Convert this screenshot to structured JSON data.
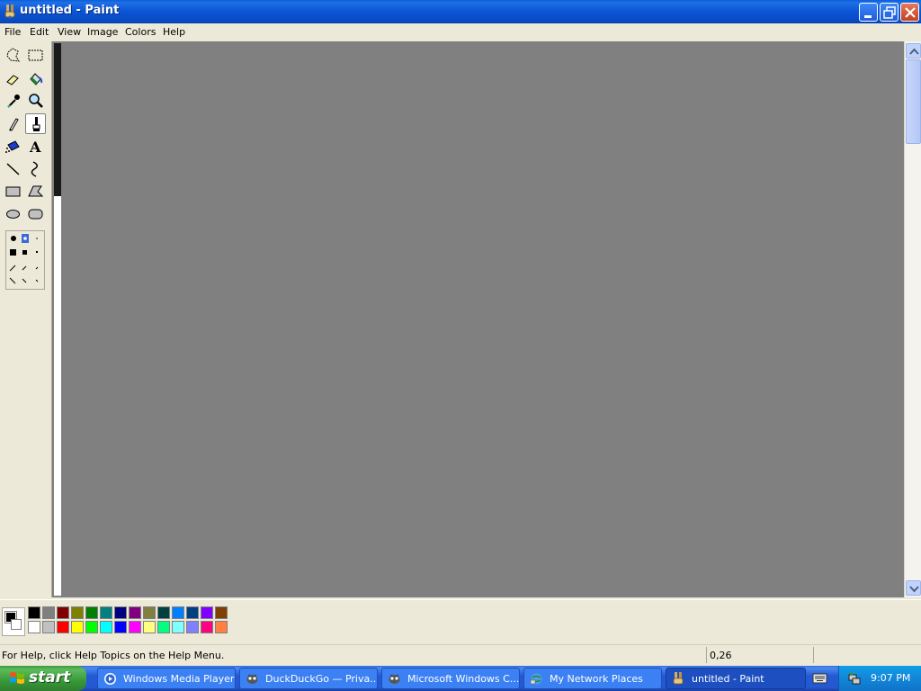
{
  "window": {
    "title": "untitled - Paint",
    "controls": {
      "minimize": "minimize",
      "maximize": "restore",
      "close": "close"
    }
  },
  "menubar": {
    "items": [
      {
        "label": "File"
      },
      {
        "label": "Edit"
      },
      {
        "label": "View"
      },
      {
        "label": "Image"
      },
      {
        "label": "Colors"
      },
      {
        "label": "Help"
      }
    ]
  },
  "toolbox": {
    "tools": [
      {
        "name": "free-form-select",
        "icon": "free-form-select-icon"
      },
      {
        "name": "select",
        "icon": "rectangle-select-icon"
      },
      {
        "name": "eraser",
        "icon": "eraser-icon"
      },
      {
        "name": "fill-with-color",
        "icon": "paint-bucket-icon"
      },
      {
        "name": "pick-color",
        "icon": "eyedropper-icon"
      },
      {
        "name": "magnifier",
        "icon": "magnifier-icon"
      },
      {
        "name": "pencil",
        "icon": "pencil-icon"
      },
      {
        "name": "brush",
        "icon": "brush-icon",
        "selected": true
      },
      {
        "name": "airbrush",
        "icon": "airbrush-icon"
      },
      {
        "name": "text",
        "icon": "text-icon"
      },
      {
        "name": "line",
        "icon": "line-icon"
      },
      {
        "name": "curve",
        "icon": "curve-icon"
      },
      {
        "name": "rectangle",
        "icon": "rectangle-icon"
      },
      {
        "name": "polygon",
        "icon": "polygon-icon"
      },
      {
        "name": "ellipse",
        "icon": "ellipse-icon"
      },
      {
        "name": "rounded-rectangle",
        "icon": "rounded-rectangle-icon"
      }
    ],
    "text_tool_glyph": "A"
  },
  "palette": {
    "foreground": "#000000",
    "background": "#ffffff",
    "colors_row1": [
      "#000000",
      "#808080",
      "#800000",
      "#808000",
      "#008000",
      "#008080",
      "#000080",
      "#800080",
      "#808040",
      "#004040",
      "#0080ff",
      "#004080",
      "#8000ff",
      "#804000"
    ],
    "colors_row2": [
      "#ffffff",
      "#c0c0c0",
      "#ff0000",
      "#ffff00",
      "#00ff00",
      "#00ffff",
      "#0000ff",
      "#ff00ff",
      "#ffff80",
      "#00ff80",
      "#80ffff",
      "#8080ff",
      "#ff0080",
      "#ff8040"
    ]
  },
  "statusbar": {
    "help_text": "For Help, click Help Topics on the Help Menu.",
    "coordinates": "0,26"
  },
  "taskbar": {
    "start_label": "start",
    "tasks": [
      {
        "label": "Windows Media Player",
        "icon": "media-player-icon",
        "active": false
      },
      {
        "label": "DuckDuckGo — Priva...",
        "icon": "browser-icon",
        "active": false
      },
      {
        "label": "Microsoft Windows C...",
        "icon": "browser-icon",
        "active": false
      },
      {
        "label": "My Network Places",
        "icon": "network-places-icon",
        "active": false
      },
      {
        "label": "untitled - Paint",
        "icon": "paint-icon",
        "active": true
      }
    ],
    "clock": "9:07 PM"
  }
}
